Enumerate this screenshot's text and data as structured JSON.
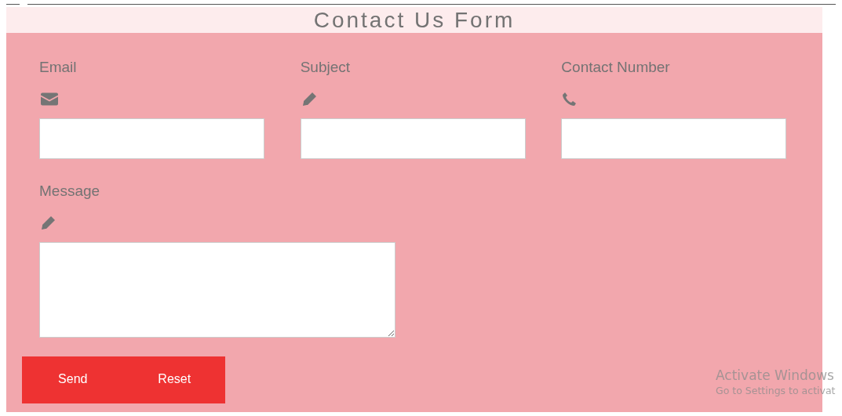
{
  "title": "Contact Us Form",
  "fields": [
    {
      "label": "Email",
      "kind": "email"
    },
    {
      "label": "Subject",
      "kind": "text"
    },
    {
      "label": "Contact Number",
      "kind": "phone"
    },
    {
      "label": "Message",
      "kind": "message"
    }
  ],
  "buttons": [
    "Send",
    "Reset"
  ],
  "activation_notice": {
    "title": "Activate Windows",
    "text": "Go to Settings to activat"
  }
}
